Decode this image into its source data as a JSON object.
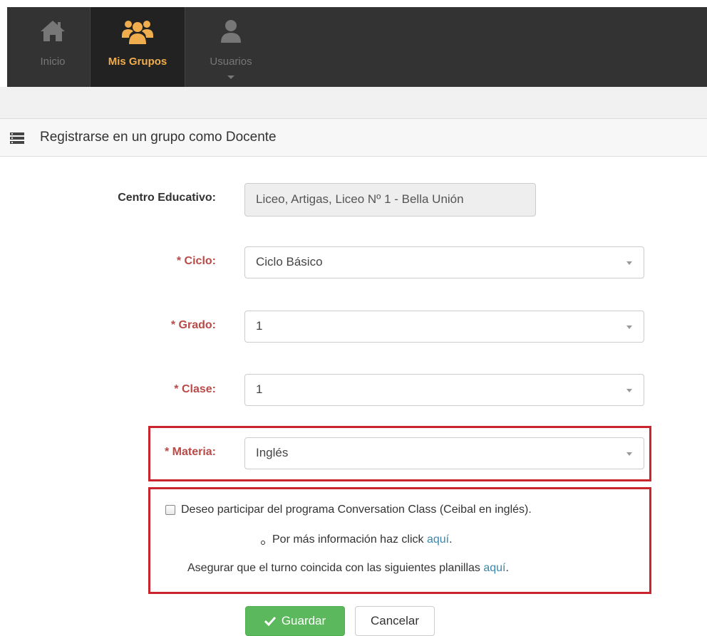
{
  "nav": {
    "items": [
      {
        "label": "Inicio",
        "icon": "home-icon"
      },
      {
        "label": "Mis Grupos",
        "icon": "group-icon",
        "active": true
      },
      {
        "label": "Usuarios",
        "icon": "user-icon",
        "dropdown": true
      }
    ],
    "accent_color": "#f0ad4e"
  },
  "panel": {
    "title": "Registrarse en un grupo como Docente",
    "icon": "list-icon"
  },
  "form": {
    "centro": {
      "label": "Centro Educativo:",
      "value": "Liceo, Artigas, Liceo Nº 1 - Bella Unión"
    },
    "ciclo": {
      "label": "* Ciclo:",
      "value": "Ciclo Básico"
    },
    "grado": {
      "label": "* Grado:",
      "value": "1"
    },
    "clase": {
      "label": "* Clase:",
      "value": "1"
    },
    "materia": {
      "label": "* Materia:",
      "value": "Inglés"
    },
    "conversation": {
      "checkbox_label": "Deseo participar del programa Conversation Class (Ceibal en inglés).",
      "checked": false,
      "info_text": "Por más información haz click ",
      "info_link": "aquí",
      "info_end": ".",
      "schedule_text": "Asegurar que el turno coincida con las siguientes planillas ",
      "schedule_link": "aquí",
      "schedule_end": "."
    },
    "save_label": "Guardar",
    "cancel_label": "Cancelar"
  },
  "colors": {
    "required": "#b94a48",
    "highlight_box": "#c9252c",
    "save_button": "#5cb85c",
    "link": "#3a87ad"
  }
}
